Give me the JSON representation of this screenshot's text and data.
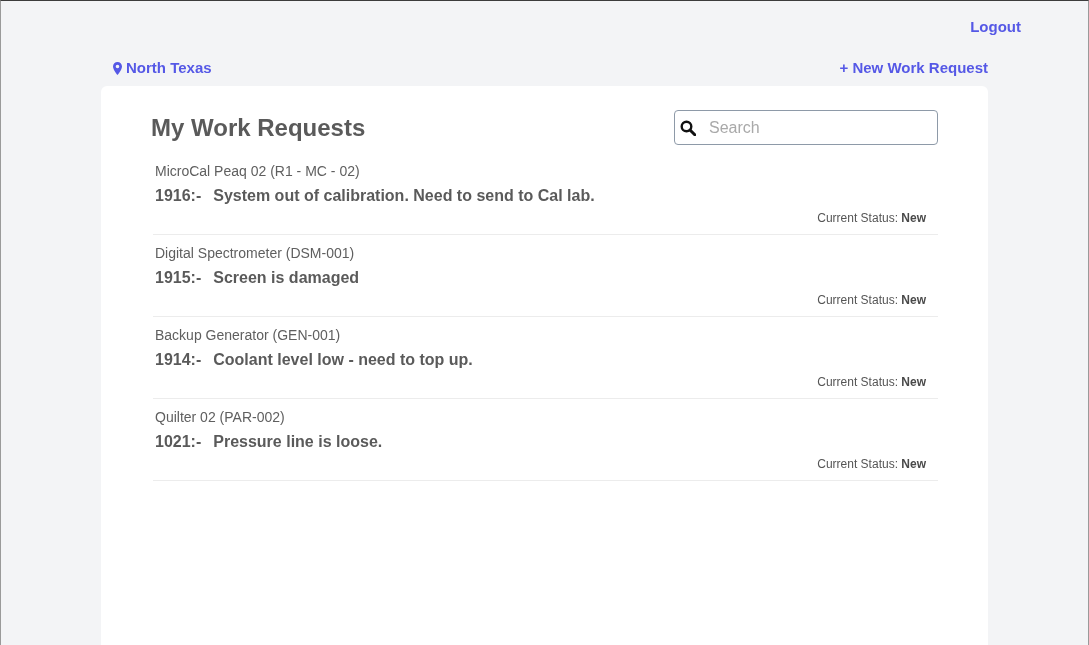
{
  "header": {
    "logout": "Logout",
    "location": "North Texas",
    "new_request": "+ New Work Request"
  },
  "panel": {
    "title": "My Work Requests",
    "search": {
      "placeholder": "Search"
    },
    "requests": [
      {
        "asset": "MicroCal Peaq 02 (R1 - MC - 02)",
        "number": "1916:-",
        "description": "System out of calibration. Need to send to Cal lab.",
        "status": "Current Status: **New**"
      },
      {
        "asset": "Digital Spectrometer (DSM-001)",
        "number": "1915:-",
        "description": "Screen is damaged",
        "status": "Current Status: **New**"
      },
      {
        "asset": "Backup Generator (GEN-001)",
        "number": "1914:-",
        "description": "Coolant level low - need to top up.",
        "status": "Current Status: **New**"
      },
      {
        "asset": "Quilter 02 (PAR-002)",
        "number": "1021:-",
        "description": "Pressure line is loose.",
        "status": "Current Status: **New**"
      }
    ]
  }
}
